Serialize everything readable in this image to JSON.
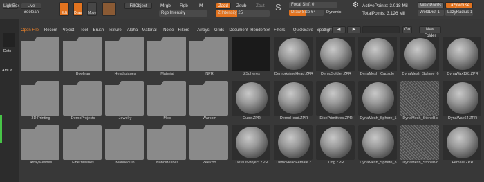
{
  "toolbar": {
    "lightbox": "LightBox",
    "liveboolean": "Live Boolean",
    "edit": "Edit",
    "draw": "Draw",
    "move": "Move",
    "fillobject": "FillObject",
    "mrgb": "Mrgb",
    "rgb": "Rgb",
    "m": "M",
    "rgb_intensity": "Rgb Intensity",
    "zadd": "Zadd",
    "zsub": "Zsub",
    "zcut": "Zcut",
    "z_intensity_label": "Z Intensity",
    "z_intensity_value": "25",
    "focal_shift_label": "Focal Shift",
    "focal_shift_value": "0",
    "draw_size_label": "Draw Size",
    "draw_size_value": "64",
    "dynamic": "Dynamic",
    "active_points": "ActivePoints: 3.018 Mil",
    "total_points": "TotalPoints: 3.126 Mil",
    "weldpoints": "WeldPoints",
    "lazymouse": "LazyMouse",
    "welddist": "WeldDist 1",
    "lazyradius": "LazyRadius 1"
  },
  "left": {
    "dots": "Dots",
    "amoc": "AmOc"
  },
  "tabs": [
    "Open File",
    "Recent",
    "Project",
    "Tool",
    "Brush",
    "Texture",
    "Alpha",
    "Material",
    "Noise",
    "Filters",
    "Arrays",
    "Grids",
    "Document",
    "RenderSet",
    "Filters",
    "QuickSave",
    "Spotlight"
  ],
  "nav": {
    "go": "Go",
    "new_folder": "New Folder"
  },
  "grid": [
    [
      "",
      "Boolean",
      "Head planes",
      "Material",
      "NPR",
      "ZSpheres",
      "DemoAnimeHead.ZPR",
      "DemoSoldier.ZPR",
      "DynaMesh_Capsule_",
      "DynaMesh_Sphere_6",
      "DynaWax128.ZPR"
    ],
    [
      "3D Printing",
      "DemoProjects",
      "Jewelry",
      "Misc",
      "Warcom",
      "Cube.ZPR",
      "DemoHead.ZPR",
      "DicePrimitives.ZPR",
      "DynaMesh_Sphere_1",
      "DynaMesh_StoneBlc",
      "DynaWax64.ZPR"
    ],
    [
      "ArrayMeshes",
      "FiberMeshes",
      "Mannequin",
      "NanoMeshes",
      "ZeeZoo",
      "DefaultProject.ZPR",
      "DemoHeadFemale.Z",
      "Dog.ZPR",
      "DynaMesh_Sphere_3",
      "DynaMesh_StoneBlc",
      "Female.ZPR"
    ]
  ]
}
